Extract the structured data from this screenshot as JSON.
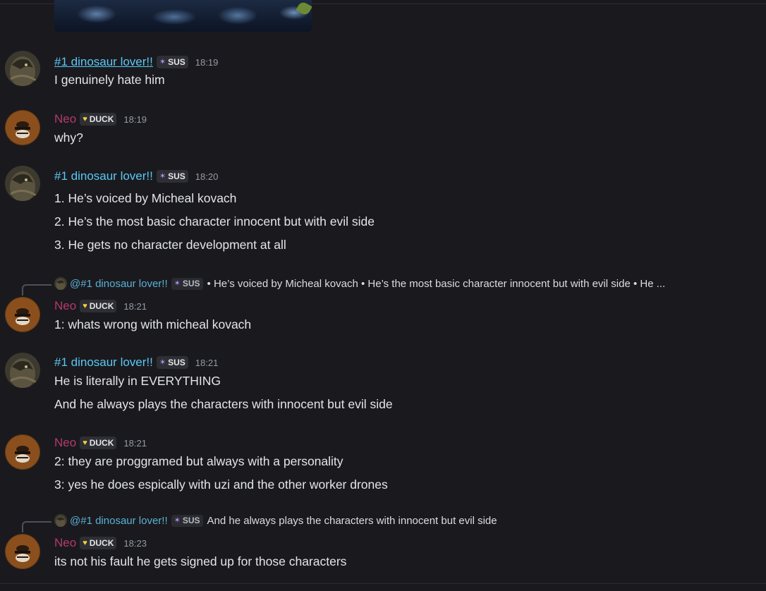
{
  "messages": [
    {
      "author": "#1 dinosaur lover!!",
      "badge": "SUS",
      "time": "18:19",
      "lines": [
        "I genuinely hate him"
      ]
    },
    {
      "author": "Neo",
      "badge": "DUCK",
      "time": "18:19",
      "lines": [
        "why?"
      ]
    },
    {
      "author": "#1 dinosaur lover!!",
      "badge": "SUS",
      "time": "18:20",
      "lines": [
        "1. He’s voiced by Micheal kovach",
        "2. He’s the most basic character innocent but with evil side",
        "3. He gets no character development at all"
      ]
    },
    {
      "reply": {
        "author": "@#1 dinosaur lover!!",
        "badge": "SUS",
        "snippet": "• He’s voiced by Micheal kovach  • He’s the most basic character innocent but with evil side  • He ..."
      },
      "author": "Neo",
      "badge": "DUCK",
      "time": "18:21",
      "lines": [
        "1: whats wrong with micheal kovach"
      ]
    },
    {
      "author": "#1 dinosaur lover!!",
      "badge": "SUS",
      "time": "18:21",
      "lines": [
        "He is literally in EVERYTHING",
        "And he always plays the characters with innocent but evil side"
      ]
    },
    {
      "author": "Neo",
      "badge": "DUCK",
      "time": "18:21",
      "lines": [
        "2: they are proggramed but always with a personality",
        "3: yes he does espically with uzi and the other worker drones"
      ]
    },
    {
      "reply": {
        "author": "@#1 dinosaur lover!!",
        "badge": "SUS",
        "snippet": "And he always plays the characters with innocent but evil side"
      },
      "author": "Neo",
      "badge": "DUCK",
      "time": "18:23",
      "lines": [
        "its not his fault he gets signed up for those characters"
      ]
    }
  ],
  "colors": {
    "background": "#1a1a1e",
    "dino_name": "#5ac8f5",
    "neo_name": "#b7386e",
    "timestamp": "#949ba4"
  },
  "icons": {
    "sus_badge": "purple-flame-icon",
    "duck_badge": "yellow-heart-icon"
  }
}
